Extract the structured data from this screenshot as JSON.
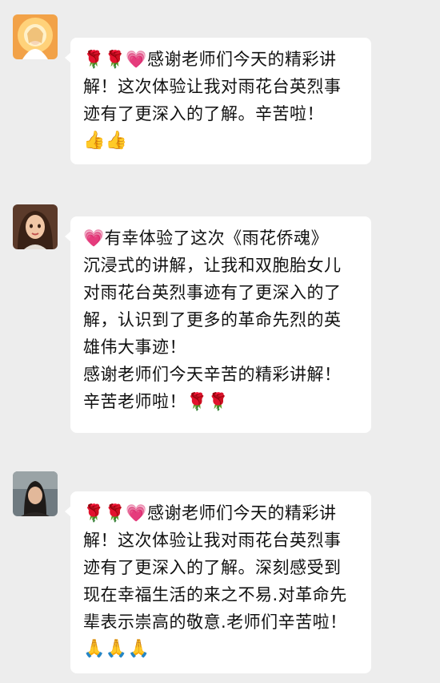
{
  "messages": [
    {
      "avatar": "avatar-sun-girl",
      "lines": [
        "🌹🌹💗感谢老师们今天的精彩讲",
        "解！这次体验让我对雨花台英烈事",
        "迹有了更深入的了解。辛苦啦！",
        "👍👍"
      ]
    },
    {
      "avatar": "avatar-cartoon-girl",
      "lines": [
        "💗有幸体验了这次《雨花侨魂》",
        "沉浸式的讲解，让我和双胞胎女儿",
        "对雨花台英烈事迹有了更深入的了",
        "解，认识到了更多的革命先烈的英",
        "雄伟大事迹！",
        "感谢老师们今天辛苦的精彩讲解！",
        "辛苦老师啦！🌹🌹"
      ]
    },
    {
      "avatar": "avatar-photo-woman",
      "lines": [
        "🌹🌹💗感谢老师们今天的精彩讲",
        "解！这次体验让我对雨花台英烈事",
        "迹有了更深入的了解。深刻感受到",
        "现在幸福生活的来之不易.对革命先",
        "辈表示崇高的敬意.老师们辛苦啦！",
        "🙏🙏🙏"
      ]
    }
  ]
}
